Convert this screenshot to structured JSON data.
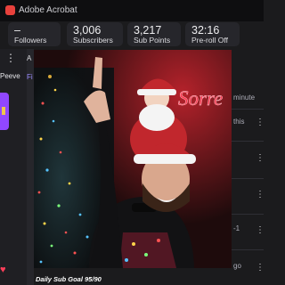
{
  "window": {
    "title": "Adobe Acrobat"
  },
  "stats": [
    {
      "value": "–",
      "label": "Followers"
    },
    {
      "value": "3,006",
      "label": "Subscribers"
    },
    {
      "value": "3,217",
      "label": "Sub Points"
    },
    {
      "value": "32:16",
      "label": "Pre-roll Off"
    }
  ],
  "left_panel": {
    "label": "Peeve"
  },
  "middle_panel": {
    "header": "A",
    "tab": "Fi"
  },
  "right_panel": {
    "row1": "minute",
    "row2": "this",
    "row3": "-1",
    "row4": "go"
  },
  "video": {
    "neon_sign": "Sorre"
  },
  "overlay": {
    "daily_goal": "Daily Sub Goal 95/90"
  },
  "colors": {
    "accent": "#9147ff",
    "app_icon": "#e8413c",
    "heart": "#ff3f5a"
  }
}
